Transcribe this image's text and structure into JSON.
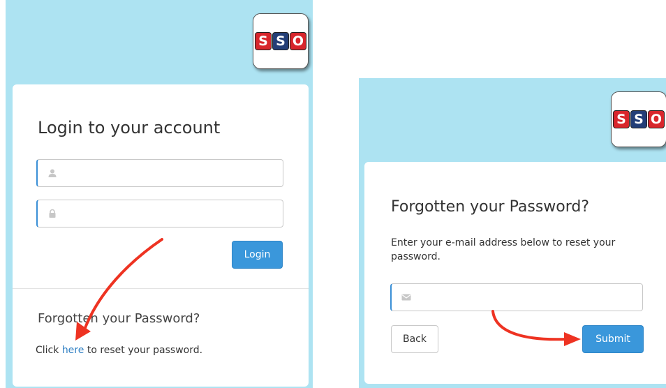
{
  "brand": {
    "logo_letters": [
      "S",
      "S",
      "O"
    ],
    "colors": {
      "red": "#d8262c",
      "navy": "#233e77",
      "panel_bg": "#ade3f2",
      "primary": "#3a97db",
      "link": "#2f7fc3",
      "annotation_arrow": "#ee3322"
    }
  },
  "login": {
    "title": "Login to your account",
    "username_icon": "user-icon",
    "password_icon": "lock-icon",
    "username_value": "",
    "password_value": "",
    "login_label": "Login",
    "forgot_heading": "Forgotten your Password?",
    "reset_prefix": "Click ",
    "reset_link": "here",
    "reset_suffix": " to reset your password."
  },
  "forgot": {
    "title": "Forgotten your Password?",
    "instructions": "Enter your e-mail address below to reset your password.",
    "email_icon": "envelope-icon",
    "email_value": "",
    "back_label": "Back",
    "submit_label": "Submit"
  }
}
